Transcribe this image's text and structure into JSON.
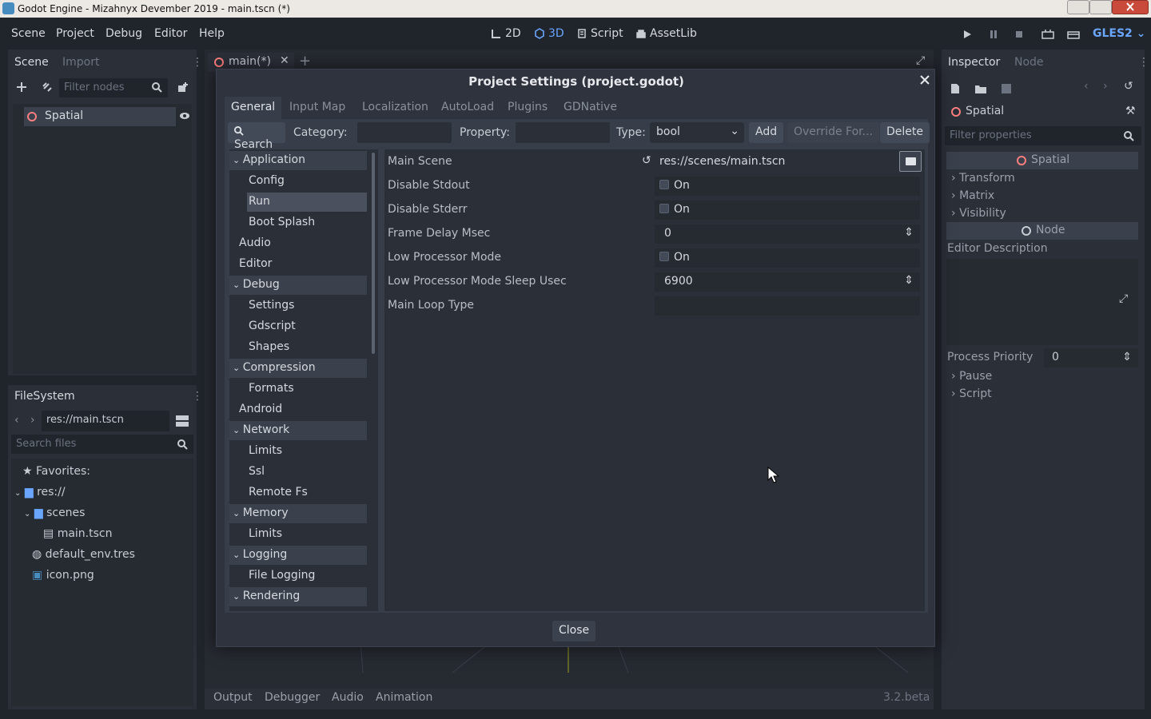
{
  "window": {
    "title": "Godot Engine - Mizahnyx Devember 2019 - main.tscn (*)"
  },
  "menu": {
    "items": [
      "Scene",
      "Project",
      "Debug",
      "Editor",
      "Help"
    ]
  },
  "workspaces": {
    "items": [
      "2D",
      "3D",
      "Script",
      "AssetLib"
    ],
    "active": "3D"
  },
  "renderer": "GLES2",
  "scene_dock": {
    "tabs": [
      "Scene",
      "Import"
    ],
    "filter_placeholder": "Filter nodes",
    "root_node": "Spatial"
  },
  "filesystem_dock": {
    "title": "FileSystem",
    "path": "res://main.tscn",
    "search_placeholder": "Search files",
    "items": [
      "Favorites:",
      "res://",
      "scenes",
      "main.tscn",
      "default_env.tres",
      "icon.png"
    ]
  },
  "editor_tabs": {
    "scene_tab": "main(*)"
  },
  "bottom_panel": {
    "tabs": [
      "Output",
      "Debugger",
      "Audio",
      "Animation"
    ],
    "version": "3.2.beta"
  },
  "inspector": {
    "tabs": [
      "Inspector",
      "Node"
    ],
    "object": "Spatial",
    "filter_placeholder": "Filter properties",
    "sections": [
      "Spatial",
      "Transform",
      "Matrix",
      "Visibility",
      "Node",
      "Editor Description"
    ],
    "process_priority_label": "Process Priority",
    "process_priority_value": "0",
    "extra": [
      "Pause",
      "Script"
    ]
  },
  "dialog": {
    "title": "Project Settings (project.godot)",
    "tabs": [
      "General",
      "Input Map",
      "Localization",
      "AutoLoad",
      "Plugins",
      "GDNative"
    ],
    "search_label": "Search",
    "category_label": "Category:",
    "property_label": "Property:",
    "type_label": "Type:",
    "type_value": "bool",
    "add_label": "Add",
    "override_label": "Override For...",
    "delete_label": "Delete",
    "close_label": "Close",
    "tree": [
      {
        "label": "Application",
        "cat": true
      },
      {
        "label": "Config"
      },
      {
        "label": "Run",
        "selected": true
      },
      {
        "label": "Boot Splash"
      },
      {
        "label": "Audio",
        "top": true
      },
      {
        "label": "Editor",
        "top": true
      },
      {
        "label": "Debug",
        "cat": true
      },
      {
        "label": "Settings"
      },
      {
        "label": "Gdscript"
      },
      {
        "label": "Shapes"
      },
      {
        "label": "Compression",
        "cat": true
      },
      {
        "label": "Formats"
      },
      {
        "label": "Android",
        "top": true
      },
      {
        "label": "Network",
        "cat": true
      },
      {
        "label": "Limits"
      },
      {
        "label": "Ssl"
      },
      {
        "label": "Remote Fs"
      },
      {
        "label": "Memory",
        "cat": true
      },
      {
        "label": "Limits"
      },
      {
        "label": "Logging",
        "cat": true
      },
      {
        "label": "File Logging"
      },
      {
        "label": "Rendering",
        "cat": true
      }
    ],
    "props": [
      {
        "label": "Main Scene",
        "value": "res://scenes/main.tscn",
        "kind": "path"
      },
      {
        "label": "Disable Stdout",
        "value": "On",
        "kind": "check"
      },
      {
        "label": "Disable Stderr",
        "value": "On",
        "kind": "check"
      },
      {
        "label": "Frame Delay Msec",
        "value": "0",
        "kind": "spin"
      },
      {
        "label": "Low Processor Mode",
        "value": "On",
        "kind": "check"
      },
      {
        "label": "Low Processor Mode Sleep Usec",
        "value": "6900",
        "kind": "spin"
      },
      {
        "label": "Main Loop Type",
        "value": "",
        "kind": "text"
      }
    ]
  }
}
